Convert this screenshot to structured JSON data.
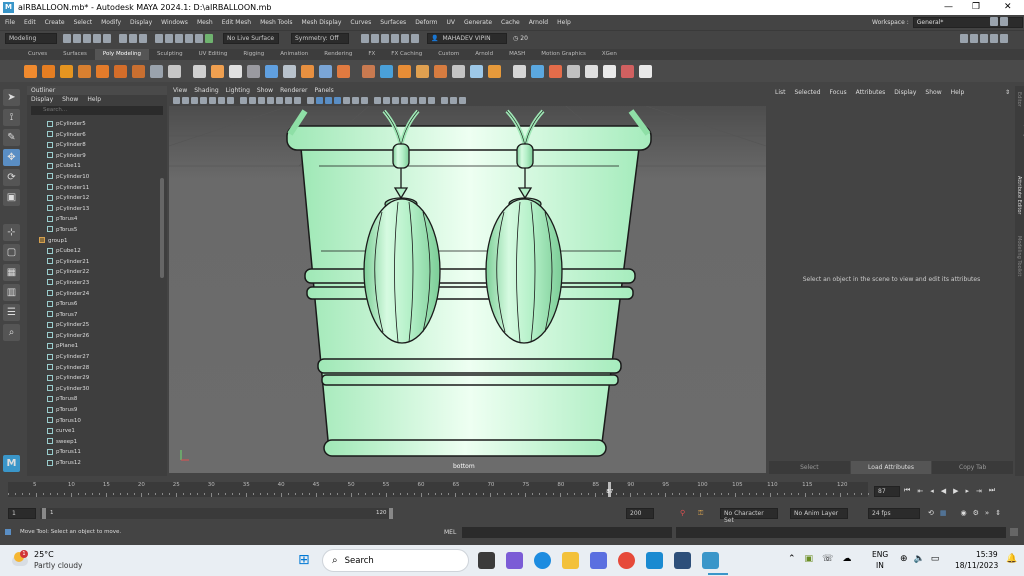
{
  "titlebar": {
    "title": "aIRBALLOON.mb* - Autodesk MAYA 2024.1: D:\\aIRBALLOON.mb",
    "app_icon": "M",
    "minimize": "—",
    "maximize": "❐",
    "close": "✕"
  },
  "menubar": {
    "items": [
      "File",
      "Edit",
      "Create",
      "Select",
      "Modify",
      "Display",
      "Windows",
      "Mesh",
      "Edit Mesh",
      "Mesh Tools",
      "Mesh Display",
      "Curves",
      "Surfaces",
      "Deform",
      "UV",
      "Generate",
      "Cache",
      "Arnold",
      "Help"
    ],
    "workspace_label": "Workspace :",
    "workspace_value": "General*"
  },
  "statusline": {
    "menuset": "Modeling",
    "live_surface": "No Live Surface",
    "symmetry": "Symmetry: Off",
    "user": "MAHADEV VIPIN",
    "count": "20"
  },
  "shelf": {
    "tabs": [
      "Curves",
      "Surfaces",
      "Poly Modeling",
      "Sculpting",
      "UV Editing",
      "Rigging",
      "Animation",
      "Rendering",
      "FX",
      "FX Caching",
      "Custom",
      "Arnold",
      "MASH",
      "Motion Graphics",
      "XGen"
    ],
    "active_tab": "Poly Modeling"
  },
  "outliner": {
    "title": "Outliner",
    "menu": [
      "Display",
      "Show",
      "Help"
    ],
    "search_placeholder": "Search...",
    "items": [
      "pCylinder5",
      "pCylinder6",
      "pCylinder8",
      "pCylinder9",
      "pCube11",
      "pCylinder10",
      "pCylinder11",
      "pCylinder12",
      "pCylinder13",
      "pTorus4",
      "pTorus5",
      "group1",
      "pCube12",
      "pCylinder21",
      "pCylinder22",
      "pCylinder23",
      "pCylinder24",
      "pTorus6",
      "pTorus7",
      "pCylinder25",
      "pCylinder26",
      "pPlane1",
      "pCylinder27",
      "pCylinder28",
      "pCylinder29",
      "pCylinder30",
      "pTorus8",
      "pTorus9",
      "pTorus10",
      "curve1",
      "sweep1",
      "pTorus11",
      "pTorus12"
    ]
  },
  "viewport": {
    "menu": [
      "View",
      "Shading",
      "Lighting",
      "Show",
      "Renderer",
      "Panels"
    ],
    "camera_label": "bottom",
    "mesh_color": "#a6f0c0"
  },
  "attribute_editor": {
    "menu": [
      "List",
      "Selected",
      "Focus",
      "Attributes",
      "Display",
      "Show",
      "Help"
    ],
    "message": "Select an object in the scene to view and edit its attributes",
    "buttons": [
      "Select",
      "Load Attributes",
      "Copy Tab"
    ],
    "side_tabs": [
      "Channel Box / Layer Editor",
      "Attribute Editor",
      "Modeling Toolkit"
    ]
  },
  "timeslider": {
    "ticks": [
      5,
      10,
      15,
      20,
      25,
      30,
      35,
      40,
      45,
      50,
      55,
      60,
      65,
      70,
      75,
      80,
      85,
      90,
      95,
      100,
      105,
      110,
      115,
      120
    ],
    "current_frame": "87",
    "current_frame_field": "87"
  },
  "rangeslider": {
    "start": "1",
    "start_inner": "1",
    "end_inner": "120",
    "end": "200",
    "character_set": "No Character Set",
    "anim_layer": "No Anim Layer",
    "fps": "24 fps"
  },
  "commandline": {
    "help_text": "Move Tool: Select an object to move.",
    "lang": "MEL"
  },
  "taskbar": {
    "weather_temp": "25°C",
    "weather_desc": "Partly cloudy",
    "weather_badge": "1",
    "search_label": "Search",
    "lang_top": "ENG",
    "lang_bottom": "IN",
    "time": "15:39",
    "date": "18/11/2023"
  }
}
